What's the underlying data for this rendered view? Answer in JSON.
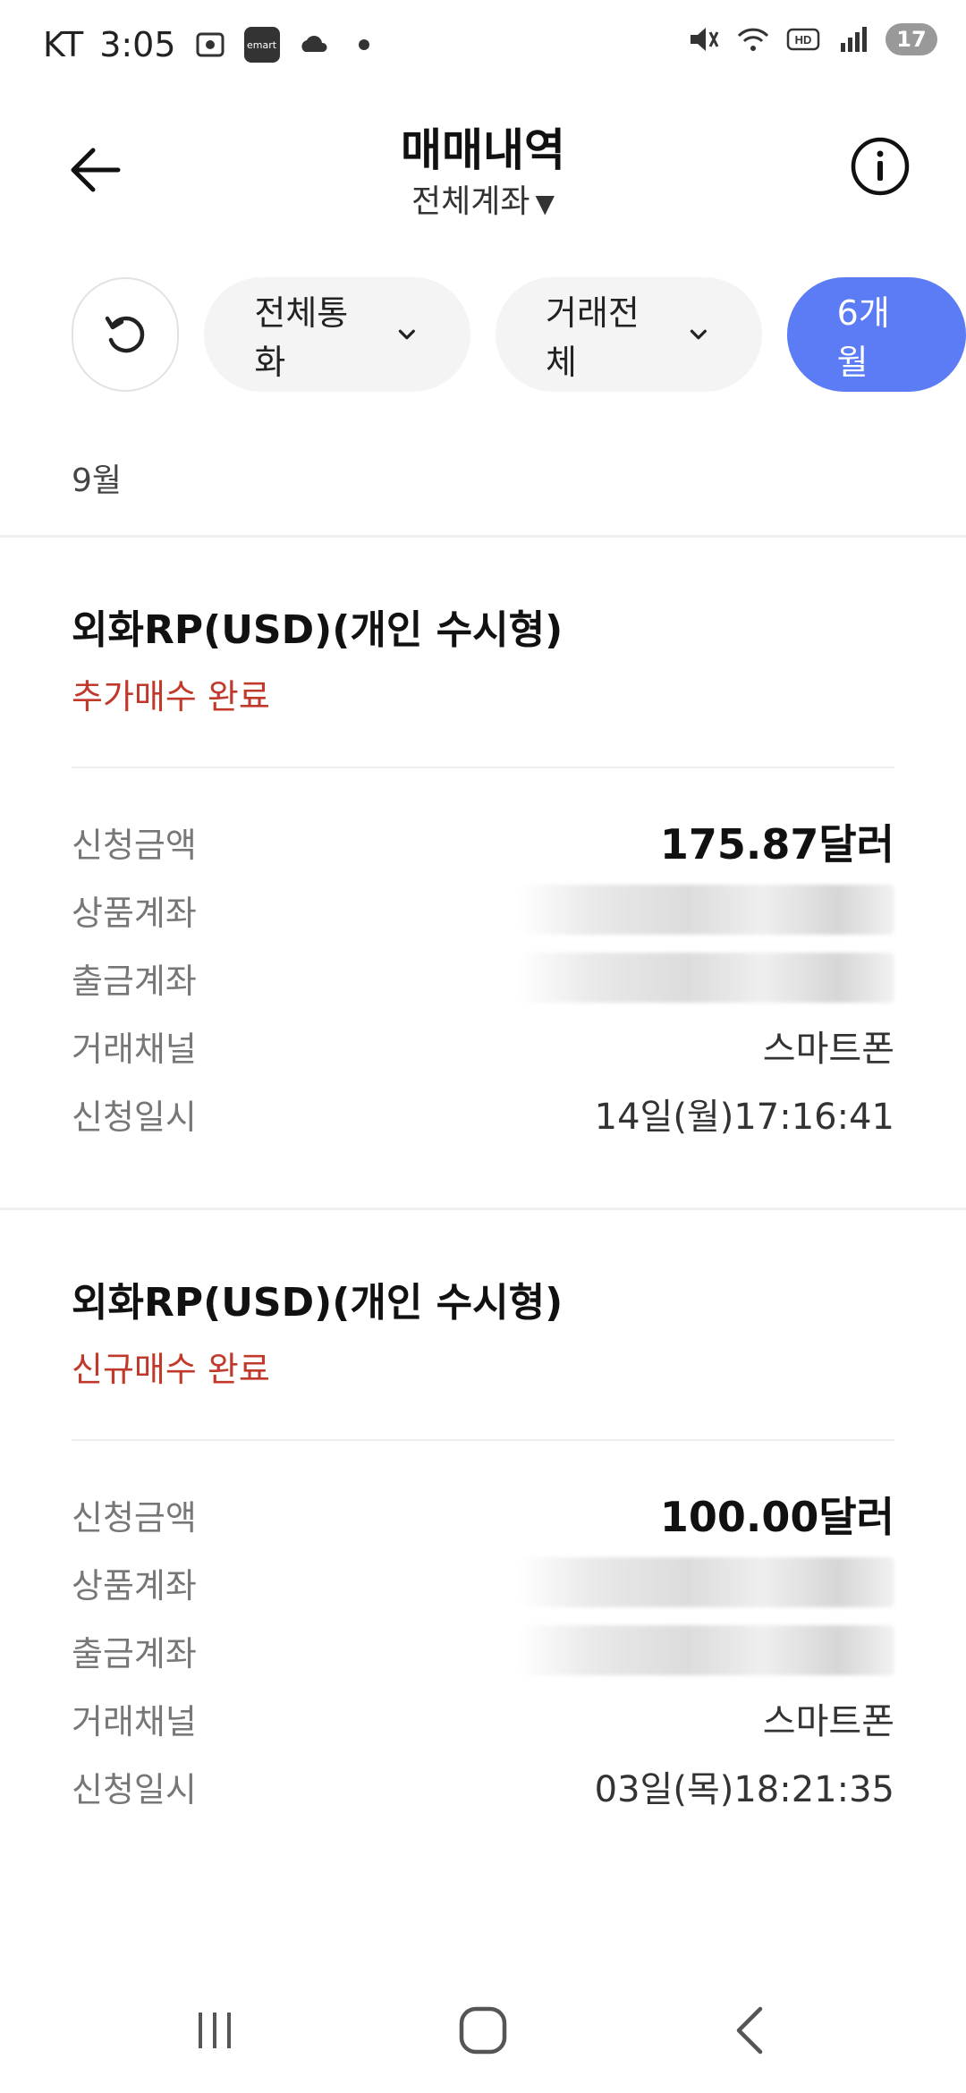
{
  "status_bar": {
    "carrier": "KT",
    "time": "3:05",
    "emart_badge": "emart",
    "battery": "17",
    "hd_label": "HD"
  },
  "header": {
    "title": "매매내역",
    "subtitle": "전체계좌",
    "subtitle_caret": "▼"
  },
  "filters": {
    "currency": "전체통화",
    "trade": "거래전체",
    "period": "6개월"
  },
  "month_label": "9월",
  "colors": {
    "accent": "#5b7cf5",
    "status_red": "#c0392b"
  },
  "cards": [
    {
      "title": "외화RP(USD)(개인 수시형)",
      "status": "추가매수 완료",
      "rows": [
        {
          "label": "신청금액",
          "value": "175.87달러"
        },
        {
          "label": "상품계좌",
          "value": ""
        },
        {
          "label": "출금계좌",
          "value": ""
        },
        {
          "label": "거래채널",
          "value": "스마트폰"
        },
        {
          "label": "신청일시",
          "value": "14일(월)17:16:41"
        }
      ]
    },
    {
      "title": "외화RP(USD)(개인 수시형)",
      "status": "신규매수 완료",
      "rows": [
        {
          "label": "신청금액",
          "value": "100.00달러"
        },
        {
          "label": "상품계좌",
          "value": ""
        },
        {
          "label": "출금계좌",
          "value": ""
        },
        {
          "label": "거래채널",
          "value": "스마트폰"
        },
        {
          "label": "신청일시",
          "value": "03일(목)18:21:35"
        }
      ]
    }
  ]
}
